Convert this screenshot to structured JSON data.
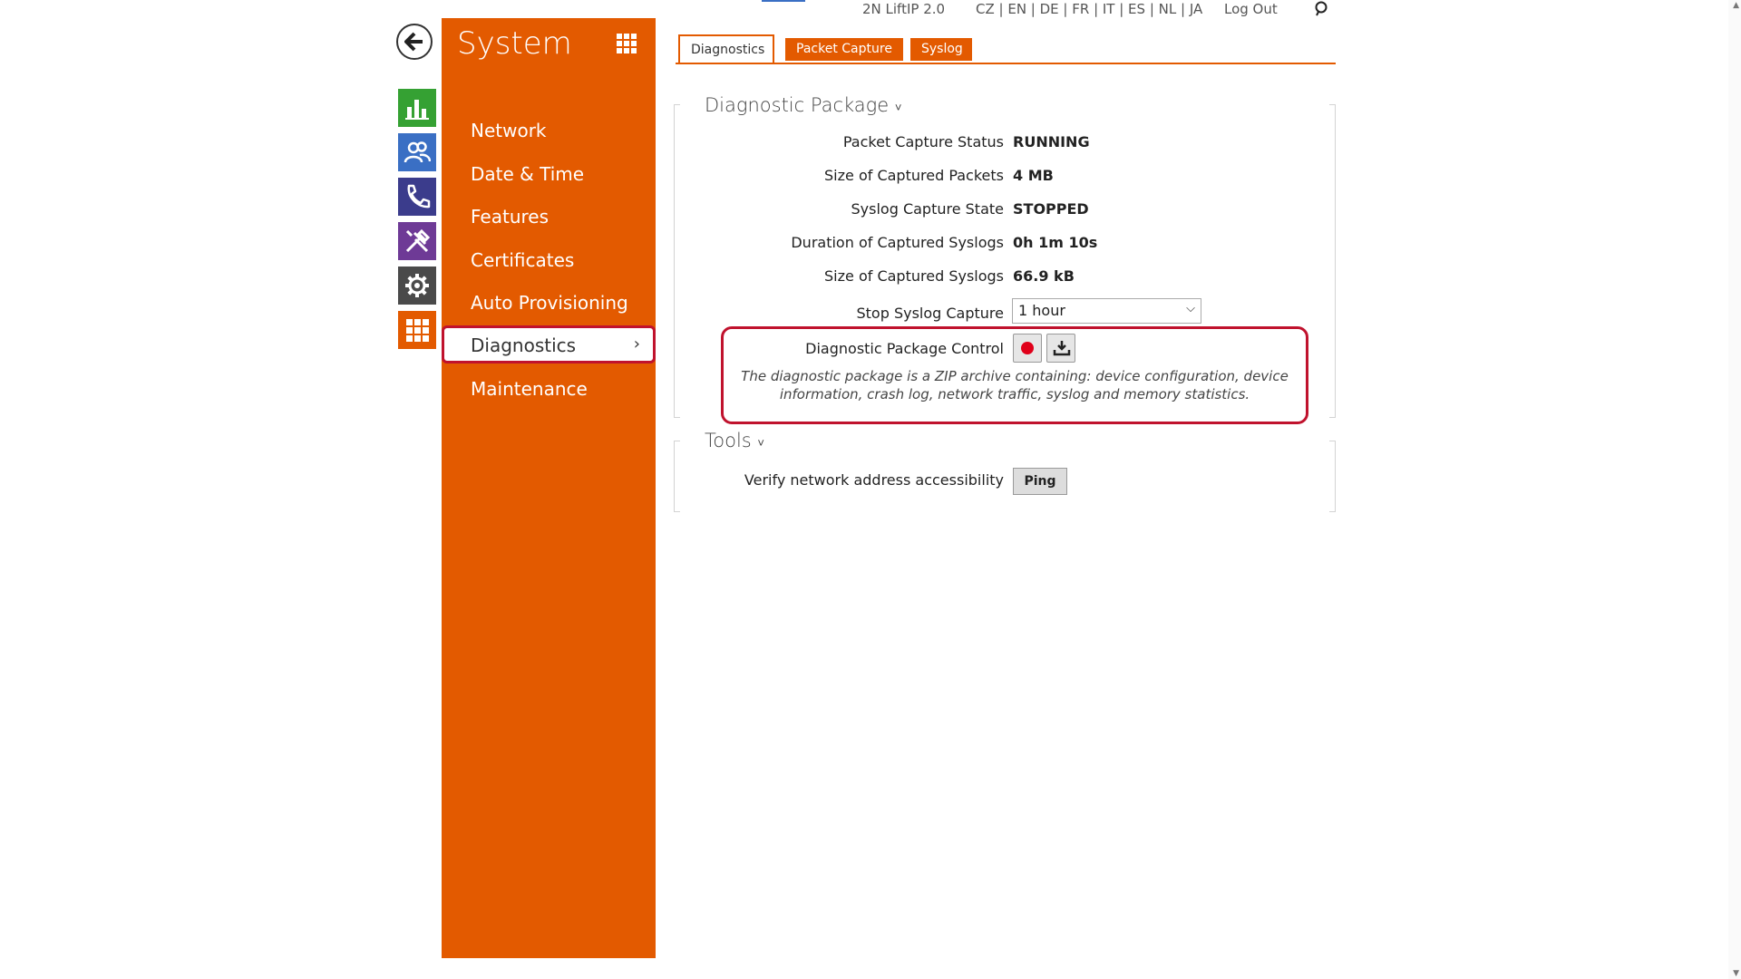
{
  "header": {
    "device": "2N LiftIP 2.0",
    "languages": "CZ | EN | DE | FR | IT | ES | NL | JA",
    "logout": "Log Out"
  },
  "rail": {
    "icons": [
      "back-arrow-icon",
      "statistics-icon",
      "users-icon",
      "phone-icon",
      "tools-icon",
      "gear-icon",
      "apps-grid-icon"
    ]
  },
  "sidebar": {
    "title": "System",
    "items": [
      {
        "label": "Network"
      },
      {
        "label": "Date & Time"
      },
      {
        "label": "Features"
      },
      {
        "label": "Certificates"
      },
      {
        "label": "Auto Provisioning"
      },
      {
        "label": "Diagnostics",
        "active": true
      },
      {
        "label": "Maintenance"
      }
    ]
  },
  "tabs": {
    "diagnostics": "Diagnostics",
    "packet_capture": "Packet Capture",
    "syslog": "Syslog"
  },
  "diag_package": {
    "title": "Diagnostic Package",
    "rows": [
      {
        "label": "Packet Capture Status",
        "value": "RUNNING"
      },
      {
        "label": "Size of Captured Packets",
        "value": "4 MB"
      },
      {
        "label": "Syslog Capture State",
        "value": "STOPPED"
      },
      {
        "label": "Duration of Captured Syslogs",
        "value": "0h 1m 10s"
      },
      {
        "label": "Size of Captured Syslogs",
        "value": "66.9 kB"
      }
    ],
    "stop_label": "Stop Syslog Capture",
    "stop_value": "1 hour",
    "control_label": "Diagnostic Package Control",
    "description": "The diagnostic package is a ZIP archive containing: device configuration, device information, crash log, network traffic, syslog and memory statistics."
  },
  "tools": {
    "title": "Tools",
    "verify_label": "Verify network address accessibility",
    "ping_label": "Ping"
  },
  "colors": {
    "accent": "#e35a00",
    "highlight": "#c0122d",
    "record": "#e0001a"
  }
}
